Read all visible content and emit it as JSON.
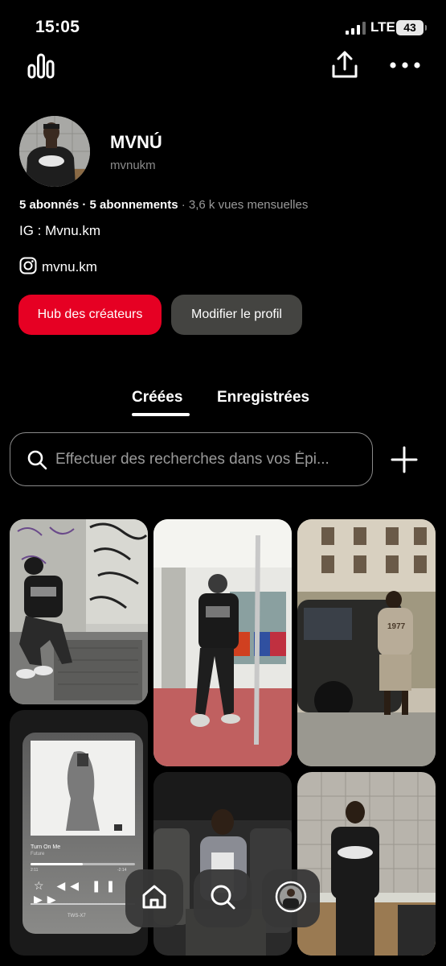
{
  "status": {
    "time": "15:05",
    "network": "LTE",
    "battery": "43"
  },
  "profile": {
    "display_name": "MVNÚ",
    "username": "mvnukm",
    "followers": "5 abonnés",
    "following": "5 abonnements",
    "monthly_views": "3,6 k vues mensuelles",
    "bio": "IG : Mvnu.km",
    "instagram_handle": "mvnu.km"
  },
  "buttons": {
    "hub": "Hub des créateurs",
    "edit": "Modifier le profil"
  },
  "tabs": [
    {
      "label": "Créées",
      "active": true
    },
    {
      "label": "Enregistrées",
      "active": false
    }
  ],
  "search": {
    "placeholder": "Effectuer des recherches dans vos Épi..."
  },
  "player_card": {
    "song": "Turn On Me",
    "artist": "Future",
    "time_elapsed": "2:11",
    "time_remaining": "-2:14",
    "device": "TWS-X7"
  },
  "pin_texts": {
    "shirt": "1977"
  },
  "colors": {
    "accent": "#e60023",
    "secondary_button": "#444441",
    "background": "#000000"
  },
  "icons": [
    "stats-icon",
    "share-icon",
    "more-icon",
    "instagram-icon",
    "search-icon",
    "plus-icon",
    "home-icon",
    "profile-avatar-icon"
  ]
}
